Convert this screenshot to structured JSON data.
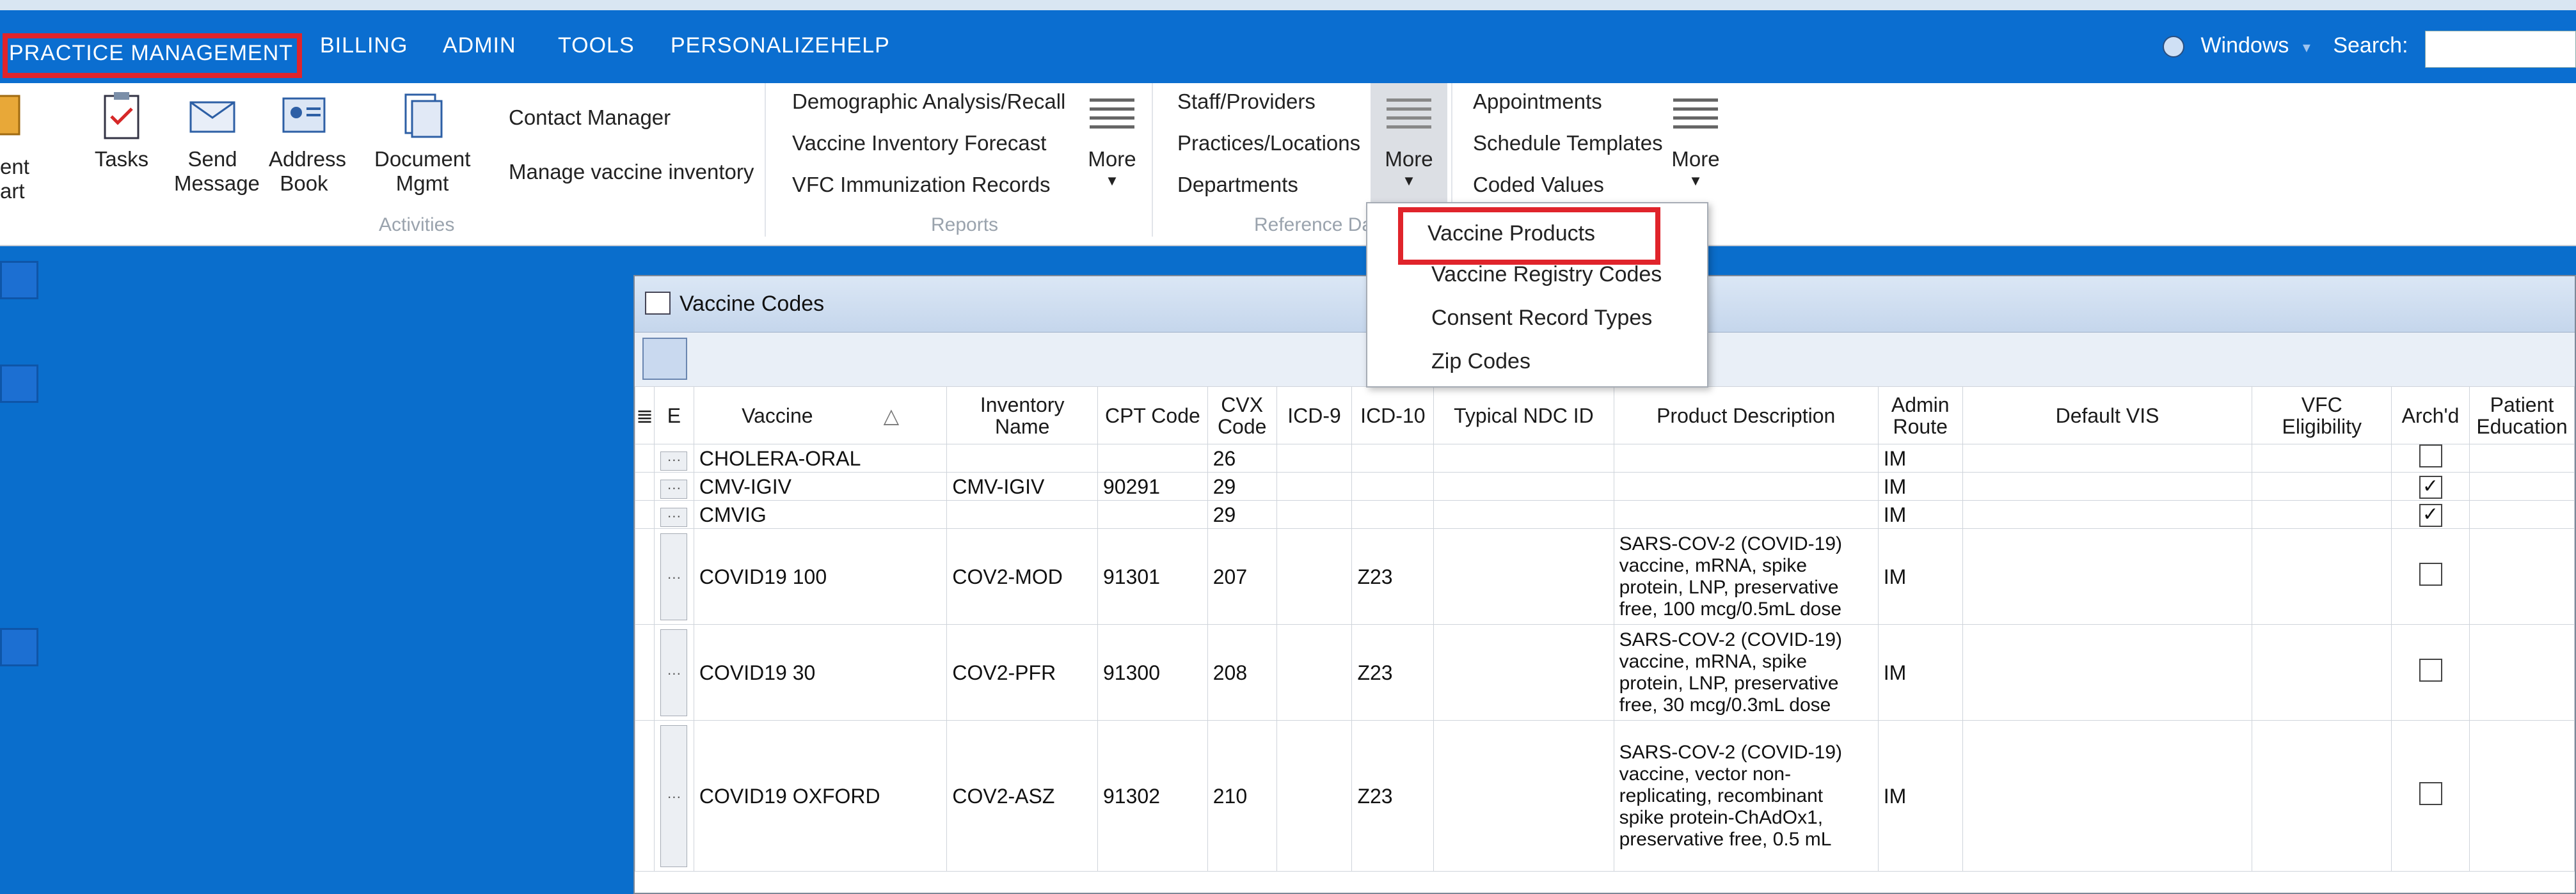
{
  "menu": {
    "practice_management": "PRACTICE MANAGEMENT",
    "billing": "BILLING",
    "admin": "ADMIN",
    "tools": "TOOLS",
    "personalize": "PERSONALIZE",
    "help": "HELP",
    "windows": "Windows",
    "search_label": "Search:",
    "search_value": ""
  },
  "ribbon": {
    "tasks": "Tasks",
    "send_message_1": "Send",
    "send_message_2": "Message",
    "address_book_1": "Address",
    "address_book_2": "Book",
    "document_mgmt_1": "Document",
    "document_mgmt_2": "Mgmt",
    "contact_manager": "Contact Manager",
    "manage_vaccine_inventory": "Manage vaccine inventory",
    "left_partial_1": "ent",
    "left_partial_2": "art",
    "activities_group": "Activities",
    "demographic_analysis": "Demographic Analysis/Recall",
    "vaccine_inventory_forecast": "Vaccine Inventory Forecast",
    "vfc_immunization_records": "VFC Immunization Records",
    "more_label": "More",
    "reports_group": "Reports",
    "staff_providers": "Staff/Providers",
    "practices_locations": "Practices/Locations",
    "departments": "Departments",
    "reference_data_group": "Reference Dat",
    "appointments": "Appointments",
    "schedule_templates": "Schedule Templates",
    "coded_values": "Coded Values"
  },
  "dropdown": {
    "items": [
      "Vaccine Products",
      "Vaccine Registry Codes",
      "Consent Record Types",
      "Zip Codes"
    ]
  },
  "window": {
    "title": "Vaccine Codes",
    "columns": {
      "e": "E",
      "vaccine": "Vaccine",
      "sort_indicator": "△",
      "inventory_name_1": "Inventory",
      "inventory_name_2": "Name",
      "cpt_code": "CPT Code",
      "cvx_code_1": "CVX",
      "cvx_code_2": "Code",
      "icd9": "ICD-9",
      "icd10": "ICD-10",
      "typical_ndc": "Typical NDC ID",
      "product_description": "Product Description",
      "admin_route_1": "Admin",
      "admin_route_2": "Route",
      "default_vis": "Default VIS",
      "vfc_eligibility_1": "VFC",
      "vfc_eligibility_2": "Eligibility",
      "archd": "Arch'd",
      "patient_education_1": "Patient",
      "patient_education_2": "Education"
    },
    "rows": [
      {
        "vaccine": "CHOLERA-ORAL",
        "inventory": "",
        "cpt": "",
        "cvx": "26",
        "icd9": "",
        "icd10": "",
        "ndc": "",
        "desc": "",
        "route": "IM",
        "vis": "",
        "vfc": "",
        "archived": false
      },
      {
        "vaccine": "CMV-IGIV",
        "inventory": "CMV-IGIV",
        "cpt": "90291",
        "cvx": "29",
        "icd9": "",
        "icd10": "",
        "ndc": "",
        "desc": "",
        "route": "IM",
        "vis": "",
        "vfc": "",
        "archived": true
      },
      {
        "vaccine": "CMVIG",
        "inventory": "",
        "cpt": "",
        "cvx": "29",
        "icd9": "",
        "icd10": "",
        "ndc": "",
        "desc": "",
        "route": "IM",
        "vis": "",
        "vfc": "",
        "archived": true
      },
      {
        "vaccine": "COVID19 100",
        "inventory": "COV2-MOD",
        "cpt": "91301",
        "cvx": "207",
        "icd9": "",
        "icd10": "Z23",
        "ndc": "",
        "desc": "SARS-COV-2 (COVID-19) vaccine, mRNA, spike protein, LNP, preservative free, 100 mcg/0.5mL dose",
        "route": "IM",
        "vis": "",
        "vfc": "",
        "archived": false
      },
      {
        "vaccine": "COVID19 30",
        "inventory": "COV2-PFR",
        "cpt": "91300",
        "cvx": "208",
        "icd9": "",
        "icd10": "Z23",
        "ndc": "",
        "desc": "SARS-COV-2 (COVID-19) vaccine, mRNA, spike protein, LNP, preservative free, 30 mcg/0.3mL dose",
        "route": "IM",
        "vis": "",
        "vfc": "",
        "archived": false
      },
      {
        "vaccine": "COVID19 OXFORD",
        "inventory": "COV2-ASZ",
        "cpt": "91302",
        "cvx": "210",
        "icd9": "",
        "icd10": "Z23",
        "ndc": "",
        "desc": "SARS-COV-2 (COVID-19) vaccine, vector non-replicating, recombinant spike protein-ChAdOx1, preservative free, 0.5 mL",
        "route": "IM",
        "vis": "",
        "vfc": "",
        "archived": false
      }
    ]
  },
  "colors": {
    "accent_blue": "#0b6ed0",
    "highlight_red": "#e0242b"
  }
}
